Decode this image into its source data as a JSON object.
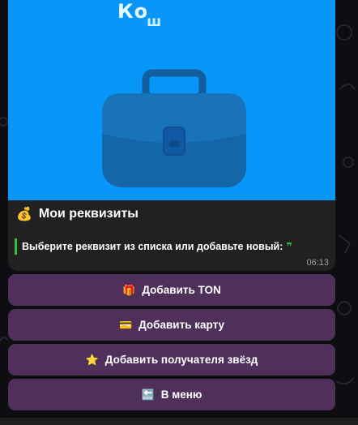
{
  "banner": {
    "logo_text": "Ко",
    "logo_sub": "ш",
    "image_icon": "briefcase-icon",
    "bg_color": "#0897f8"
  },
  "message": {
    "title_emoji": "💰",
    "title": "Мои реквизиты",
    "quote_text": "Выберите реквизит из списка или добавьте новый:",
    "quote_mark": "❞",
    "time": "06:13"
  },
  "keyboard": {
    "buttons": [
      {
        "icon": "🎁",
        "icon_name": "gift-icon",
        "label": "Добавить TON"
      },
      {
        "icon": "💳",
        "icon_name": "credit-card-icon",
        "label": "Добавить карту"
      },
      {
        "icon": "⭐",
        "icon_name": "star-icon",
        "label": "Добавить получателя звёзд"
      },
      {
        "icon": "🔙",
        "icon_name": "back-icon",
        "label": "В меню"
      }
    ]
  },
  "colors": {
    "accent_quote": "#3fb946",
    "button_bg": "#623a6e",
    "bubble_bg": "#212121"
  }
}
